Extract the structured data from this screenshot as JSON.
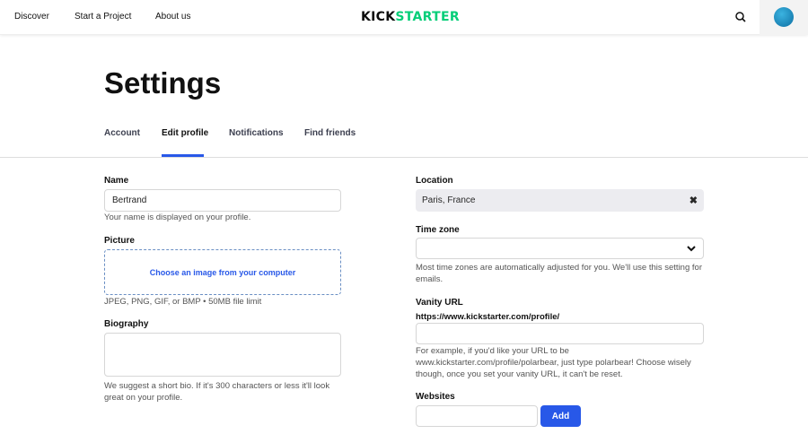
{
  "header": {
    "nav": [
      "Discover",
      "Start a Project",
      "About us"
    ],
    "logo_left": "KICK",
    "logo_right": "STARTER"
  },
  "page_title": "Settings",
  "tabs": [
    "Account",
    "Edit profile",
    "Notifications",
    "Find friends"
  ],
  "left": {
    "name_label": "Name",
    "name_value": "Bertrand",
    "name_help": "Your name is displayed on your profile.",
    "picture_label": "Picture",
    "picture_cta": "Choose an image from your computer",
    "picture_help": "JPEG, PNG, GIF, or BMP • 50MB file limit",
    "bio_label": "Biography",
    "bio_help": "We suggest a short bio. If it's 300 characters or less it'll look great on your profile."
  },
  "right": {
    "location_label": "Location",
    "location_value": "Paris, France",
    "timezone_label": "Time zone",
    "timezone_help": "Most time zones are automatically adjusted for you. We'll use this setting for emails.",
    "vanity_label": "Vanity URL",
    "vanity_prefix": "https://www.kickstarter.com/profile/",
    "vanity_help": "For example, if you'd like your URL to be www.kickstarter.com/profile/polarbear, just type polarbear! Choose wisely though, once you set your vanity URL, it can't be reset.",
    "websites_label": "Websites",
    "add_label": "Add"
  },
  "colors": {
    "accent": "#2858e8",
    "brand": "#05ce78"
  }
}
